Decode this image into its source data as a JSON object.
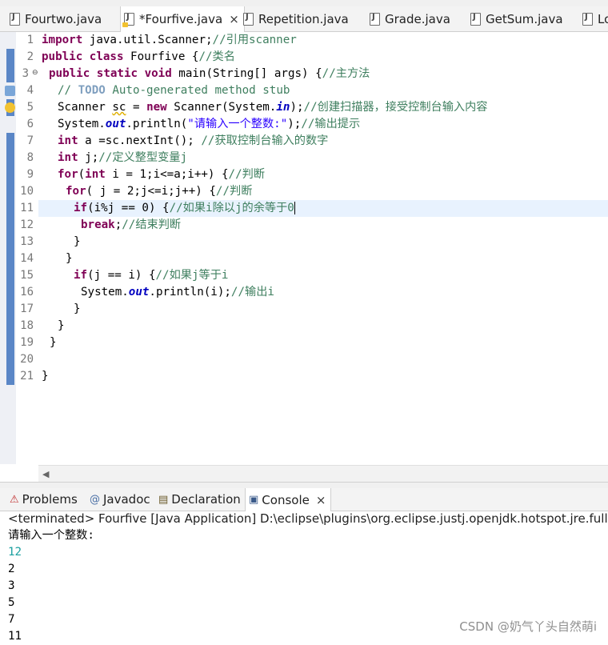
{
  "editor_tabs": [
    {
      "label": "Fourtwo.java"
    },
    {
      "label": "*Fourfive.java",
      "close": "×"
    },
    {
      "label": "Repetition.java"
    },
    {
      "label": "Grade.java"
    },
    {
      "label": "GetSum.java"
    },
    {
      "label": "Lo"
    }
  ],
  "code_lines": [
    {
      "n": "1"
    },
    {
      "n": "2"
    },
    {
      "n": "3"
    },
    {
      "n": "4"
    },
    {
      "n": "5"
    },
    {
      "n": "6"
    },
    {
      "n": "7"
    },
    {
      "n": "8"
    },
    {
      "n": "9"
    },
    {
      "n": "10"
    },
    {
      "n": "11"
    },
    {
      "n": "12"
    },
    {
      "n": "13"
    },
    {
      "n": "14"
    },
    {
      "n": "15"
    },
    {
      "n": "16"
    },
    {
      "n": "17"
    },
    {
      "n": "18"
    },
    {
      "n": "19"
    },
    {
      "n": "20"
    },
    {
      "n": "21"
    }
  ],
  "code": {
    "l1": {
      "kw": "import",
      "rest": " java.util.Scanner;",
      "comment": "//引用scanner"
    },
    "l2": {
      "kw": "public class",
      "rest": " Fourfive {",
      "comment": "//类名"
    },
    "l3": {
      "kw": "public static void",
      "rest": " main(String[] args) {",
      "comment": "//主方法"
    },
    "l4": {
      "comment_a": "// ",
      "todo": "TODO",
      "comment_b": " Auto-generated method stub"
    },
    "l5": {
      "a": "Scanner ",
      "sc": "sc",
      "b": " = ",
      "kw": "new",
      "c": " Scanner(System.",
      "fld": "in",
      "d": ");",
      "comment": "//创建扫描器，接受控制台输入内容"
    },
    "l6": {
      "a": "System.",
      "fld": "out",
      "b": ".println(",
      "str": "\"请输入一个整数:\"",
      "c": ");",
      "comment": "//输出提示"
    },
    "l7": {
      "kw": "int",
      "rest": " a =sc.nextInt(); ",
      "comment": "//获取控制台输入的数字"
    },
    "l8": {
      "kw": "int",
      "rest": " j;",
      "comment": "//定义整型变量j"
    },
    "l9": {
      "kw": "for",
      "a": "(",
      "kw2": "int",
      "b": " i = 1;i<=a;i++) {",
      "comment": "//判断"
    },
    "l10": {
      "kw": "for",
      "rest": "( j = 2;j<=i;j++) {",
      "comment": "//判断"
    },
    "l11": {
      "kw": "if",
      "rest": "(i%j == 0) {",
      "comment": "//如果i除以j的余等于0"
    },
    "l12": {
      "kw": "break",
      "rest": ";",
      "comment": "//结束判断"
    },
    "l13": {
      "rest": "}"
    },
    "l14": {
      "rest": "}"
    },
    "l15": {
      "kw": "if",
      "rest": "(j == i) {",
      "comment": "//如果j等于i"
    },
    "l16": {
      "a": "System.",
      "fld": "out",
      "b": ".println(i);",
      "comment": "//输出i"
    },
    "l17": {
      "rest": "}"
    },
    "l18": {
      "rest": "}"
    },
    "l19": {
      "rest": "}"
    },
    "l21": {
      "rest": "}"
    }
  },
  "view_tabs": {
    "problems": "Problems",
    "javadoc": "Javadoc",
    "declaration": "Declaration",
    "console": "Console",
    "console_close": "×"
  },
  "console": {
    "header": "<terminated> Fourfive [Java Application] D:\\eclipse\\plugins\\org.eclipse.justj.openjdk.hotspot.jre.full.win",
    "prompt": "请输入一个整数:",
    "input": "12",
    "outputs": [
      "2",
      "3",
      "5",
      "7",
      "11"
    ]
  },
  "watermark": "CSDN @奶气丫头自然萌i",
  "colors": {
    "keyword": "#7f0055",
    "comment": "#3f7f5f",
    "string": "#2a00ff",
    "field": "#0000c0",
    "console_input": "#1ba0a0",
    "change_bar": "#5a86c6"
  }
}
